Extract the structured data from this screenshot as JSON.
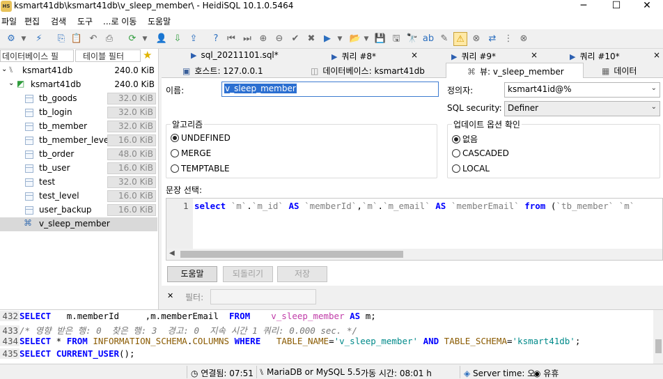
{
  "window": {
    "title": "ksmart41db\\ksmart41db\\v_sleep_member\\ - HeidiSQL 10.1.0.5464",
    "app_icon_text": "HS",
    "controls": {
      "minimize": "─",
      "maximize": "☐",
      "close": "✕"
    }
  },
  "menu": [
    "파일",
    "편집",
    "검색",
    "도구",
    "...로 이동",
    "도움말"
  ],
  "left_panel": {
    "db_filter_placeholder": "데이터베이스 필",
    "table_filter_placeholder": "테이블 필터",
    "tree": [
      {
        "label": "ksmart41db",
        "size": "240.0 KiB",
        "level": 0
      },
      {
        "label": "ksmart41db",
        "size": "240.0 KiB",
        "level": 1
      },
      {
        "label": "tb_goods",
        "size": "32.0 KiB",
        "level": 2
      },
      {
        "label": "tb_login",
        "size": "32.0 KiB",
        "level": 2
      },
      {
        "label": "tb_member",
        "size": "32.0 KiB",
        "level": 2
      },
      {
        "label": "tb_member_level",
        "size": "16.0 KiB",
        "level": 2
      },
      {
        "label": "tb_order",
        "size": "48.0 KiB",
        "level": 2
      },
      {
        "label": "tb_user",
        "size": "16.0 KiB",
        "level": 2
      },
      {
        "label": "test",
        "size": "32.0 KiB",
        "level": 2
      },
      {
        "label": "test_level",
        "size": "16.0 KiB",
        "level": 2
      },
      {
        "label": "user_backup",
        "size": "16.0 KiB",
        "level": 2
      },
      {
        "label": "v_sleep_member",
        "size": "",
        "level": 2
      }
    ]
  },
  "query_tabs": [
    "sql_20211101.sql*",
    "쿼리 #8*",
    "쿼리 #9*",
    "쿼리 #10*"
  ],
  "close_glyph": "×",
  "object_tabs": [
    "호스트: 127.0.0.1",
    "데이터베이스: ksmart41db",
    "뷰: v_sleep_member",
    "데이터"
  ],
  "view_editor": {
    "name_label": "이름:",
    "name_value": "v_sleep_member",
    "definer_label": "정의자:",
    "definer_value": "ksmart41id@%",
    "security_label": "SQL security:",
    "security_value": "Definer",
    "algorithm_title": "알고리즘",
    "algorithms": [
      "UNDEFINED",
      "MERGE",
      "TEMPTABLE"
    ],
    "algorithm_selected": "UNDEFINED",
    "update_title": "업데이트 옵션 확인",
    "update_options": [
      "없음",
      "CASCADED",
      "LOCAL"
    ],
    "update_selected": "없음",
    "statement_label": "문장 선택:",
    "sql_line_number": "1",
    "buttons": {
      "help": "도움말",
      "revert": "되돌리기",
      "save": "저장"
    }
  },
  "filter": {
    "label": "필터:",
    "close": "✕"
  },
  "log": [
    {
      "num": "432",
      "text": "SELECT   m.memberId     ,m.memberEmail  FROM    v_sleep_member AS m;"
    },
    {
      "num": "433",
      "text": "/* 영향 받은 행: 0  찾은 행: 3  경고: 0  지속 시간 1 쿼리: 0.000 sec. */"
    },
    {
      "num": "434",
      "text": "SELECT * FROM INFORMATION_SCHEMA.COLUMNS WHERE   TABLE_NAME='v_sleep_member' AND TABLE_SCHEMA='ksmart41db';"
    },
    {
      "num": "435",
      "text": "SELECT CURRENT_USER();"
    }
  ],
  "status": {
    "connected": "연결됨: 07:51",
    "server": "MariaDB or MySQL 5.5",
    "uptime": "가동 시간: 08:01 h",
    "server_time": "Server time: 오",
    "idle": "유휴"
  }
}
